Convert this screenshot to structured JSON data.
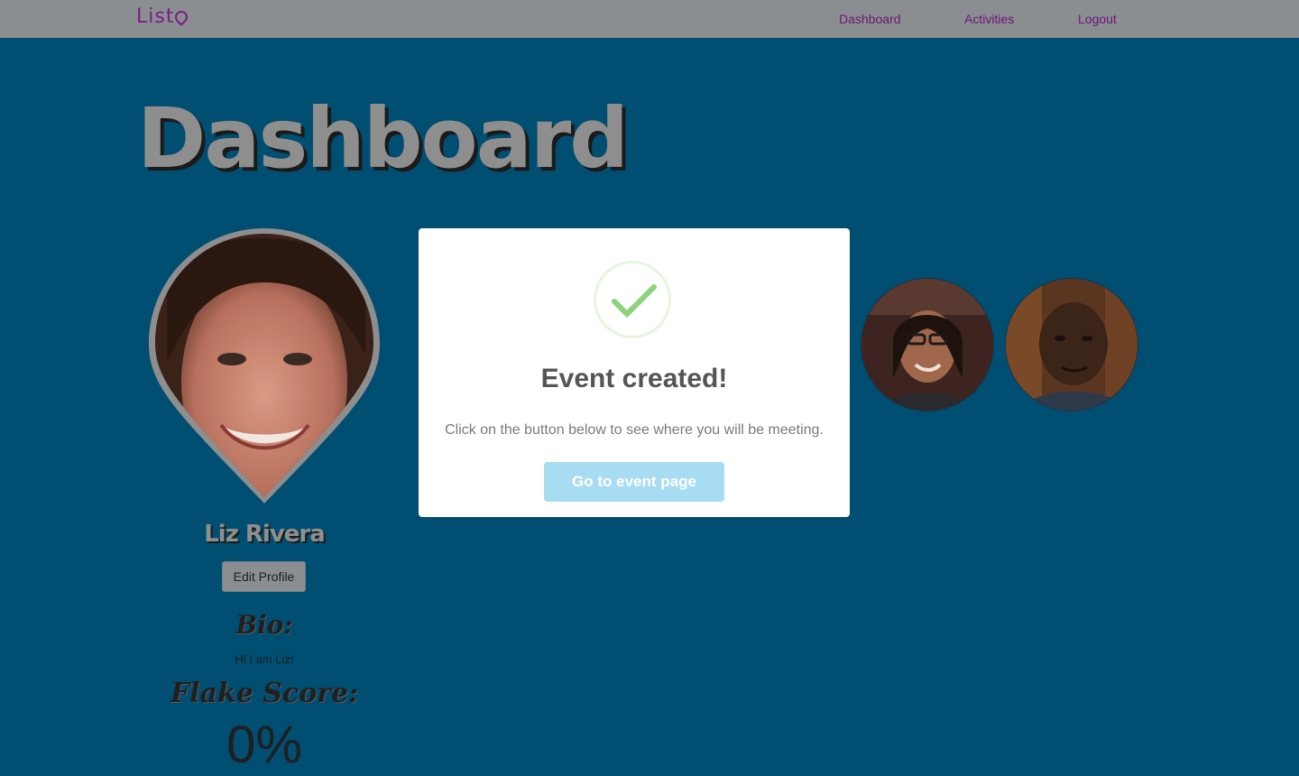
{
  "navbar": {
    "logo": "List",
    "links": [
      "Dashboard",
      "Activities",
      "Logout"
    ]
  },
  "page": {
    "title": "Dashboard"
  },
  "profile": {
    "name": "Liz Rivera",
    "edit_label": "Edit Profile",
    "bio_heading": "Bio:",
    "bio_text": "Hi I am Liz!",
    "flake_heading": "Flake Score:",
    "flake_value": "0%"
  },
  "modal": {
    "title": "Event created!",
    "message": "Click on the button below to see where you will be meeting.",
    "button_label": "Go to event page"
  },
  "colors": {
    "background": "#004e72",
    "navbar": "#8b8e91",
    "brand": "#7a1f86",
    "success": "#8bd47a",
    "button": "#a8dcf3"
  }
}
